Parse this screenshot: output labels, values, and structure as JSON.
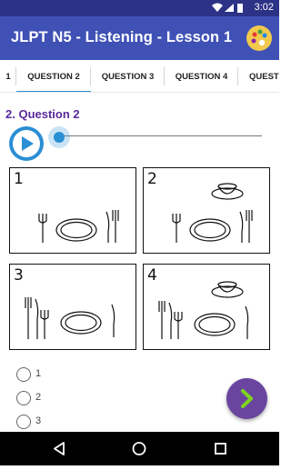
{
  "status": {
    "time": "3:02"
  },
  "appbar": {
    "title": "JLPT N5 -  Listening - Lesson 1"
  },
  "tabs": [
    {
      "label": "1"
    },
    {
      "label": "QUESTION 2"
    },
    {
      "label": "QUESTION 3"
    },
    {
      "label": "QUESTION 4"
    },
    {
      "label": "QUESTI"
    }
  ],
  "question": {
    "title": "2. Question 2"
  },
  "images": [
    {
      "number": "1"
    },
    {
      "number": "2"
    },
    {
      "number": "3"
    },
    {
      "number": "4"
    }
  ],
  "options": [
    {
      "label": "1"
    },
    {
      "label": "2"
    },
    {
      "label": "3"
    }
  ],
  "colors": {
    "appbar": "#3f51b5",
    "statusbar": "#2c3286",
    "accent": "#2a91d6",
    "title": "#5a2a9a",
    "fab": "#6a45a0"
  }
}
